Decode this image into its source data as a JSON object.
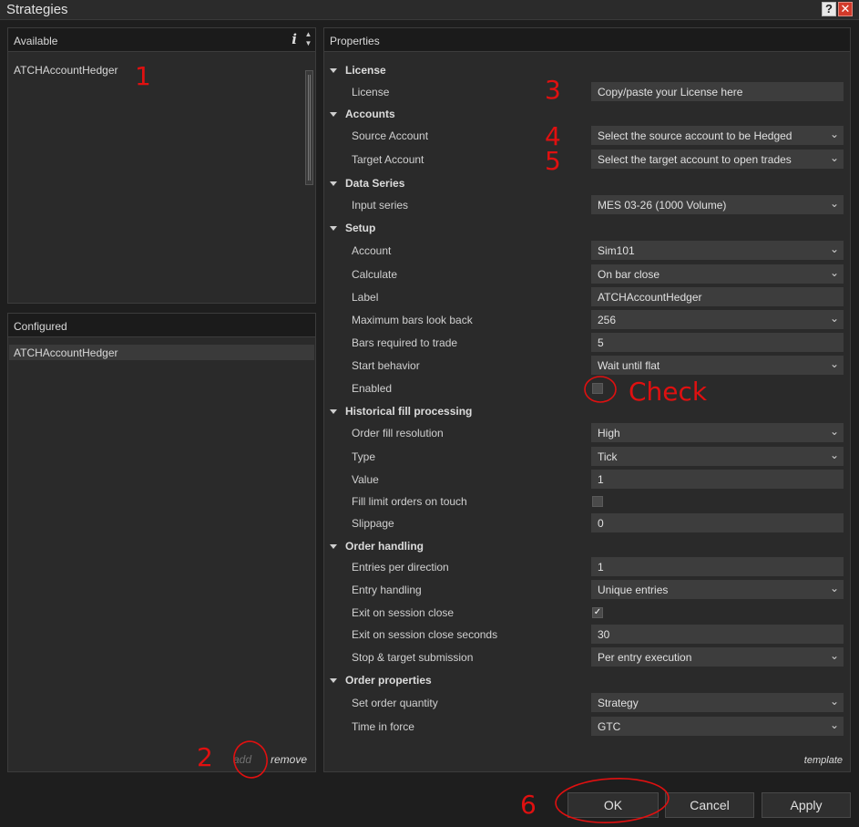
{
  "window": {
    "title": "Strategies",
    "help_label": "?",
    "close_label": "✕"
  },
  "available": {
    "header": "Available",
    "info_label": "i",
    "items": [
      "ATCHAccountHedger"
    ]
  },
  "configured": {
    "header": "Configured",
    "items": [
      "ATCHAccountHedger"
    ],
    "add_label": "add",
    "remove_label": "remove"
  },
  "properties": {
    "header": "Properties",
    "template_label": "template",
    "categories": [
      {
        "label": "License",
        "rows": [
          {
            "label": "License",
            "type": "text",
            "value": "Copy/paste  your License here"
          }
        ]
      },
      {
        "label": "Accounts",
        "rows": [
          {
            "label": "Source Account",
            "type": "select",
            "value": "Select the source account to be Hedged"
          },
          {
            "label": "Target Account",
            "type": "select",
            "value": "Select the target account to open trades"
          }
        ]
      },
      {
        "label": "Data Series",
        "rows": [
          {
            "label": "Input series",
            "type": "select",
            "value": "MES 03-26 (1000 Volume)"
          }
        ]
      },
      {
        "label": "Setup",
        "rows": [
          {
            "label": "Account",
            "type": "select",
            "value": "Sim101"
          },
          {
            "label": "Calculate",
            "type": "select",
            "value": "On bar close"
          },
          {
            "label": "Label",
            "type": "text",
            "value": "ATCHAccountHedger"
          },
          {
            "label": "Maximum bars look back",
            "type": "select",
            "value": "256"
          },
          {
            "label": "Bars required to trade",
            "type": "text",
            "value": "5"
          },
          {
            "label": "Start behavior",
            "type": "select",
            "value": "Wait until flat"
          },
          {
            "label": "Enabled",
            "type": "checkbox",
            "checked": false
          }
        ]
      },
      {
        "label": "Historical fill processing",
        "rows": [
          {
            "label": "Order fill resolution",
            "type": "select",
            "value": "High"
          },
          {
            "label": "Type",
            "type": "select",
            "value": "Tick"
          },
          {
            "label": "Value",
            "type": "text",
            "value": "1"
          },
          {
            "label": "Fill limit orders on touch",
            "type": "checkbox",
            "checked": false
          },
          {
            "label": "Slippage",
            "type": "text",
            "value": "0"
          }
        ]
      },
      {
        "label": "Order handling",
        "rows": [
          {
            "label": "Entries per direction",
            "type": "text",
            "value": "1"
          },
          {
            "label": "Entry handling",
            "type": "select",
            "value": "Unique entries"
          },
          {
            "label": "Exit on session close",
            "type": "checkbox",
            "checked": true
          },
          {
            "label": "Exit on session close seconds",
            "type": "text",
            "value": "30"
          },
          {
            "label": "Stop & target submission",
            "type": "select",
            "value": "Per entry execution"
          }
        ]
      },
      {
        "label": "Order properties",
        "rows": [
          {
            "label": "Set order quantity",
            "type": "select",
            "value": "Strategy"
          },
          {
            "label": "Time in force",
            "type": "select",
            "value": "GTC"
          }
        ]
      }
    ]
  },
  "buttons": {
    "ok": "OK",
    "cancel": "Cancel",
    "apply": "Apply"
  },
  "annotations": {
    "n1": "1",
    "n2": "2",
    "n3": "3",
    "n4": "4",
    "n5": "5",
    "n6": "6",
    "check": "Check",
    "color": "#e01010"
  },
  "icons": {
    "dropdown": "chevron-down-icon",
    "expand": "triangle-down-icon",
    "check": "checkmark-icon"
  }
}
